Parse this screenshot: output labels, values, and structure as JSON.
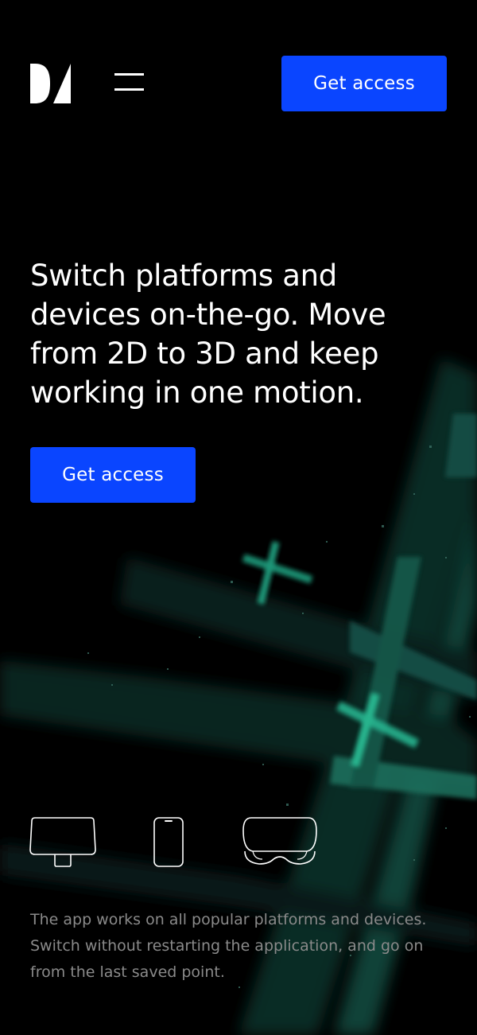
{
  "header": {
    "logo_name": "logo-mark",
    "menu_icon": "hamburger-menu-icon",
    "cta_label": "Get access"
  },
  "hero": {
    "headline": "Switch platforms and devices on-the-go. Move from 2D to 3D and keep working in one motion.",
    "cta_label": "Get access"
  },
  "devices": {
    "icons": [
      "monitor-icon",
      "phone-icon",
      "vr-headset-icon"
    ]
  },
  "footer_text": {
    "description": "The app works on all popular platforms and devices. Switch without restarting the application, and go on from the last saved point."
  },
  "colors": {
    "background": "#000000",
    "accent": "#0a45ff",
    "text_primary": "#ffffff",
    "text_secondary": "#8a8a8a",
    "glow": "#1fae88"
  }
}
